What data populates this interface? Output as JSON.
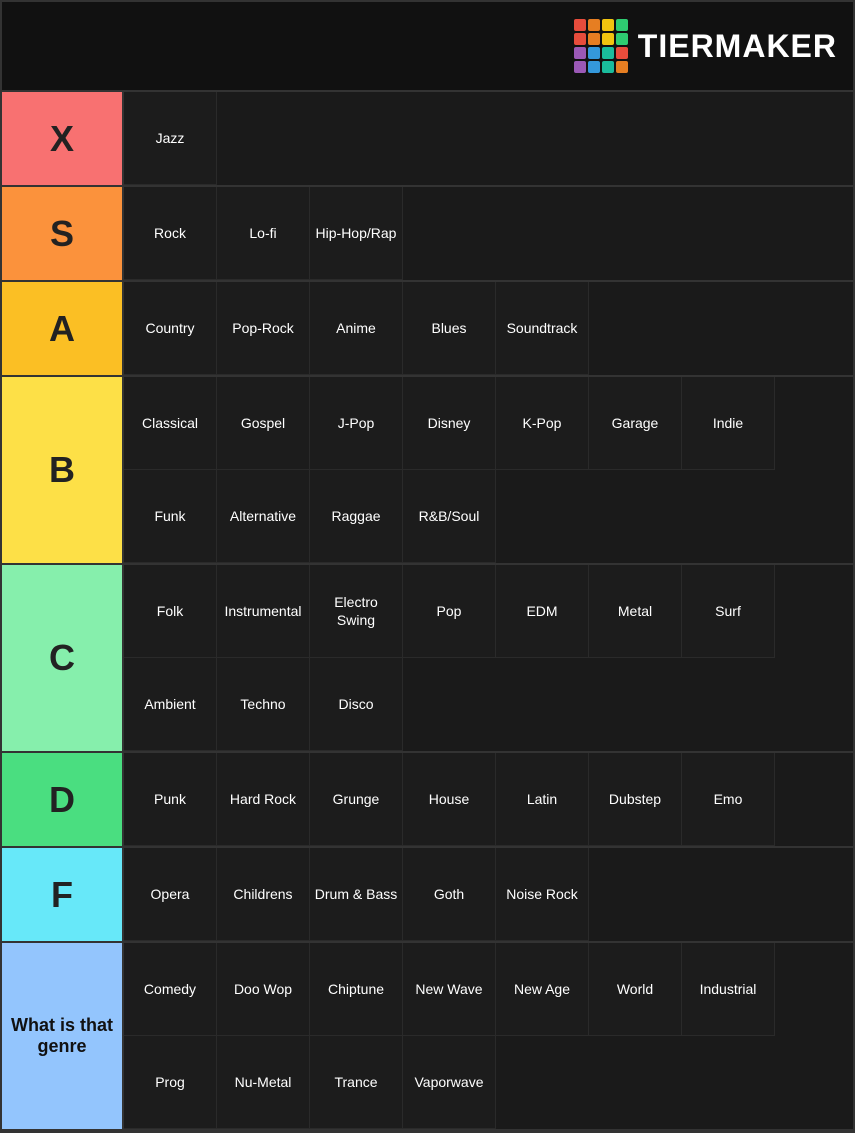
{
  "logo": {
    "text": "TiERMAKER",
    "grid_colors": [
      "#e74c3c",
      "#e67e22",
      "#f1c40f",
      "#2ecc71",
      "#e74c3c",
      "#e67e22",
      "#f1c40f",
      "#2ecc71",
      "#9b59b6",
      "#3498db",
      "#1abc9c",
      "#e74c3c",
      "#9b59b6",
      "#3498db",
      "#1abc9c",
      "#e67e22"
    ]
  },
  "tiers": [
    {
      "id": "x",
      "label": "X",
      "color": "#f87171",
      "rows": [
        [
          "Jazz"
        ]
      ]
    },
    {
      "id": "s",
      "label": "S",
      "color": "#fb923c",
      "rows": [
        [
          "Rock",
          "Lo-fi",
          "Hip-Hop/Rap"
        ]
      ]
    },
    {
      "id": "a",
      "label": "A",
      "color": "#fbbf24",
      "rows": [
        [
          "Country",
          "Pop-Rock",
          "Anime",
          "Blues",
          "Soundtrack"
        ]
      ]
    },
    {
      "id": "b",
      "label": "B",
      "color": "#fde047",
      "rows": [
        [
          "Classical",
          "Gospel",
          "J-Pop",
          "Disney",
          "K-Pop",
          "Garage",
          "Indie"
        ],
        [
          "Funk",
          "Alternative",
          "Raggae",
          "R&B/Soul"
        ]
      ]
    },
    {
      "id": "c",
      "label": "C",
      "color": "#86efac",
      "rows": [
        [
          "Folk",
          "Instrumental",
          "Electro Swing",
          "Pop",
          "EDM",
          "Metal",
          "Surf"
        ],
        [
          "Ambient",
          "Techno",
          "Disco"
        ]
      ]
    },
    {
      "id": "d",
      "label": "D",
      "color": "#4ade80",
      "rows": [
        [
          "Punk",
          "Hard Rock",
          "Grunge",
          "House",
          "Latin",
          "Dubstep",
          "Emo"
        ]
      ]
    },
    {
      "id": "f",
      "label": "F",
      "color": "#67e8f9",
      "rows": [
        [
          "Opera",
          "Childrens",
          "Drum & Bass",
          "Goth",
          "Noise Rock"
        ]
      ]
    },
    {
      "id": "what",
      "label": "What is that genre",
      "color": "#93c5fd",
      "rows": [
        [
          "Comedy",
          "Doo Wop",
          "Chiptune",
          "New Wave",
          "New Age",
          "World",
          "Industrial"
        ],
        [
          "Prog",
          "Nu-Metal",
          "Trance",
          "Vaporwave"
        ]
      ]
    }
  ]
}
